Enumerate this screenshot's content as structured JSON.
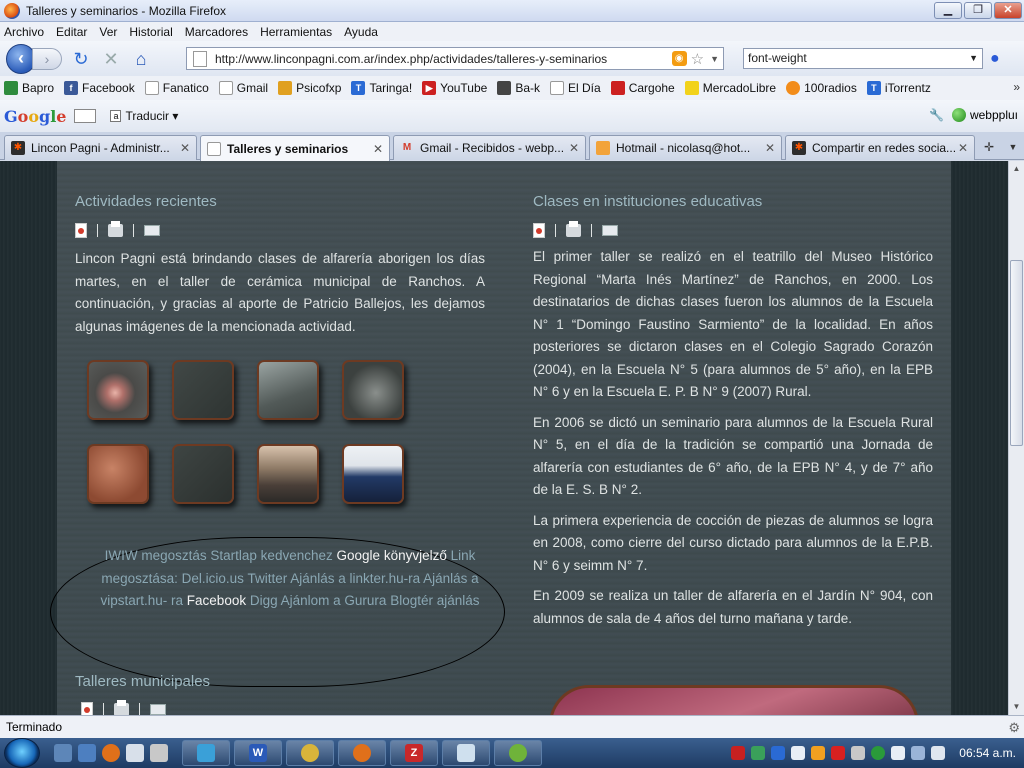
{
  "window": {
    "title": "Talleres y seminarios - Mozilla Firefox"
  },
  "menu": [
    "Archivo",
    "Editar",
    "Ver",
    "Historial",
    "Marcadores",
    "Herramientas",
    "Ayuda"
  ],
  "nav": {
    "url": "http://www.linconpagni.com.ar/index.php/actividades/talleres-y-seminarios",
    "search_value": "font-weight"
  },
  "bookmarks": [
    {
      "label": "Bapro",
      "color": "#2e8b3d"
    },
    {
      "label": "Facebook",
      "color": "#3b5998"
    },
    {
      "label": "Fanatico",
      "color": "#ffffff"
    },
    {
      "label": "Gmail",
      "color": "#ffffff"
    },
    {
      "label": "Psicofxp",
      "color": "#e0a020"
    },
    {
      "label": "Taringa!",
      "color": "#2a6ad4"
    },
    {
      "label": "YouTube",
      "color": "#cc2020"
    },
    {
      "label": "Ba-k",
      "color": "#444444"
    },
    {
      "label": "El Día",
      "color": "#ffffff"
    },
    {
      "label": "Cargohe",
      "color": "#cc2020"
    },
    {
      "label": "MercadoLibre",
      "color": "#f2d21a"
    },
    {
      "label": "100radios",
      "color": "#f28c1a"
    },
    {
      "label": "iTorrentz",
      "color": "#2a6ad4"
    }
  ],
  "google_toolbar": {
    "translate": "Traducir",
    "user": "webppluı"
  },
  "tabs": [
    {
      "label": "Lincon Pagni - Administr...",
      "active": false
    },
    {
      "label": "Talleres y seminarios",
      "active": true
    },
    {
      "label": "Gmail - Recibidos - webp...",
      "active": false
    },
    {
      "label": "Hotmail - nicolasq@hot...",
      "active": false
    },
    {
      "label": "Compartir en redes socia...",
      "active": false
    }
  ],
  "left": {
    "heading": "Actividades recientes",
    "paragraph": "Lincon Pagni está brindando clases de alfarería aborigen los días martes, en el taller de cerámica municipal de Ranchos. A continuación, y gracias al aporte de Patricio Ballejos, les dejamos algunas imágenes de la mencionada actividad.",
    "share": {
      "iwiw": "IWIW megosztás",
      "startlap": "Startlap kedvenchez",
      "google": "Google",
      "konyvjelzo": "könyvjelző",
      "link": "Link megosztása:",
      "delicious": "Del.icio.us",
      "twitter": "Twitter",
      "ajanlas_a": "Ajánlás a",
      "linkter": "linkter.hu-ra",
      "ajanlas2": "Ajánlás a",
      "vipstart": "vipstart.hu-",
      "ra": "ra",
      "facebook": "Facebook",
      "digg": "Digg",
      "gurura": "Ajánlom a Gurura",
      "blogter": "Blogtér ajánlás"
    },
    "subheading": "Talleres municipales"
  },
  "right": {
    "heading": "Clases en instituciones educativas",
    "paragraphs": [
      "El primer taller se realizó en el teatrillo del Museo Histórico Regional “Marta Inés Martínez” de Ranchos, en 2000. Los destinatarios de dichas clases fueron los alumnos de la Escuela N° 1 “Domingo Faustino Sarmiento” de la localidad. En años posteriores se dictaron clases en el Colegio Sagrado Corazón (2004), en la Escuela N° 5 (para alumnos de 5° año), en la EPB N° 6 y en la Escuela E. P. B N° 9 (2007) Rural.",
      "En 2006 se dictó un seminario para alumnos de la Escuela Rural N° 5, en el día de la tradición se compartió una Jornada de alfarería con estudiantes de 6° año, de la EPB N° 4, y de 7° año de la E. S. B N° 2.",
      "La primera experiencia de cocción de piezas de alumnos se logra en 2008, como cierre del curso dictado para alumnos de la E.P.B. N° 6 y seimm N° 7.",
      "En 2009 se realiza un taller de alfarería en el Jardín N° 904, con alumnos de sala de 4 años del turno mañana y tarde."
    ]
  },
  "status": {
    "text": "Terminado"
  },
  "taskbar": {
    "clock": "06:54 a.m."
  }
}
